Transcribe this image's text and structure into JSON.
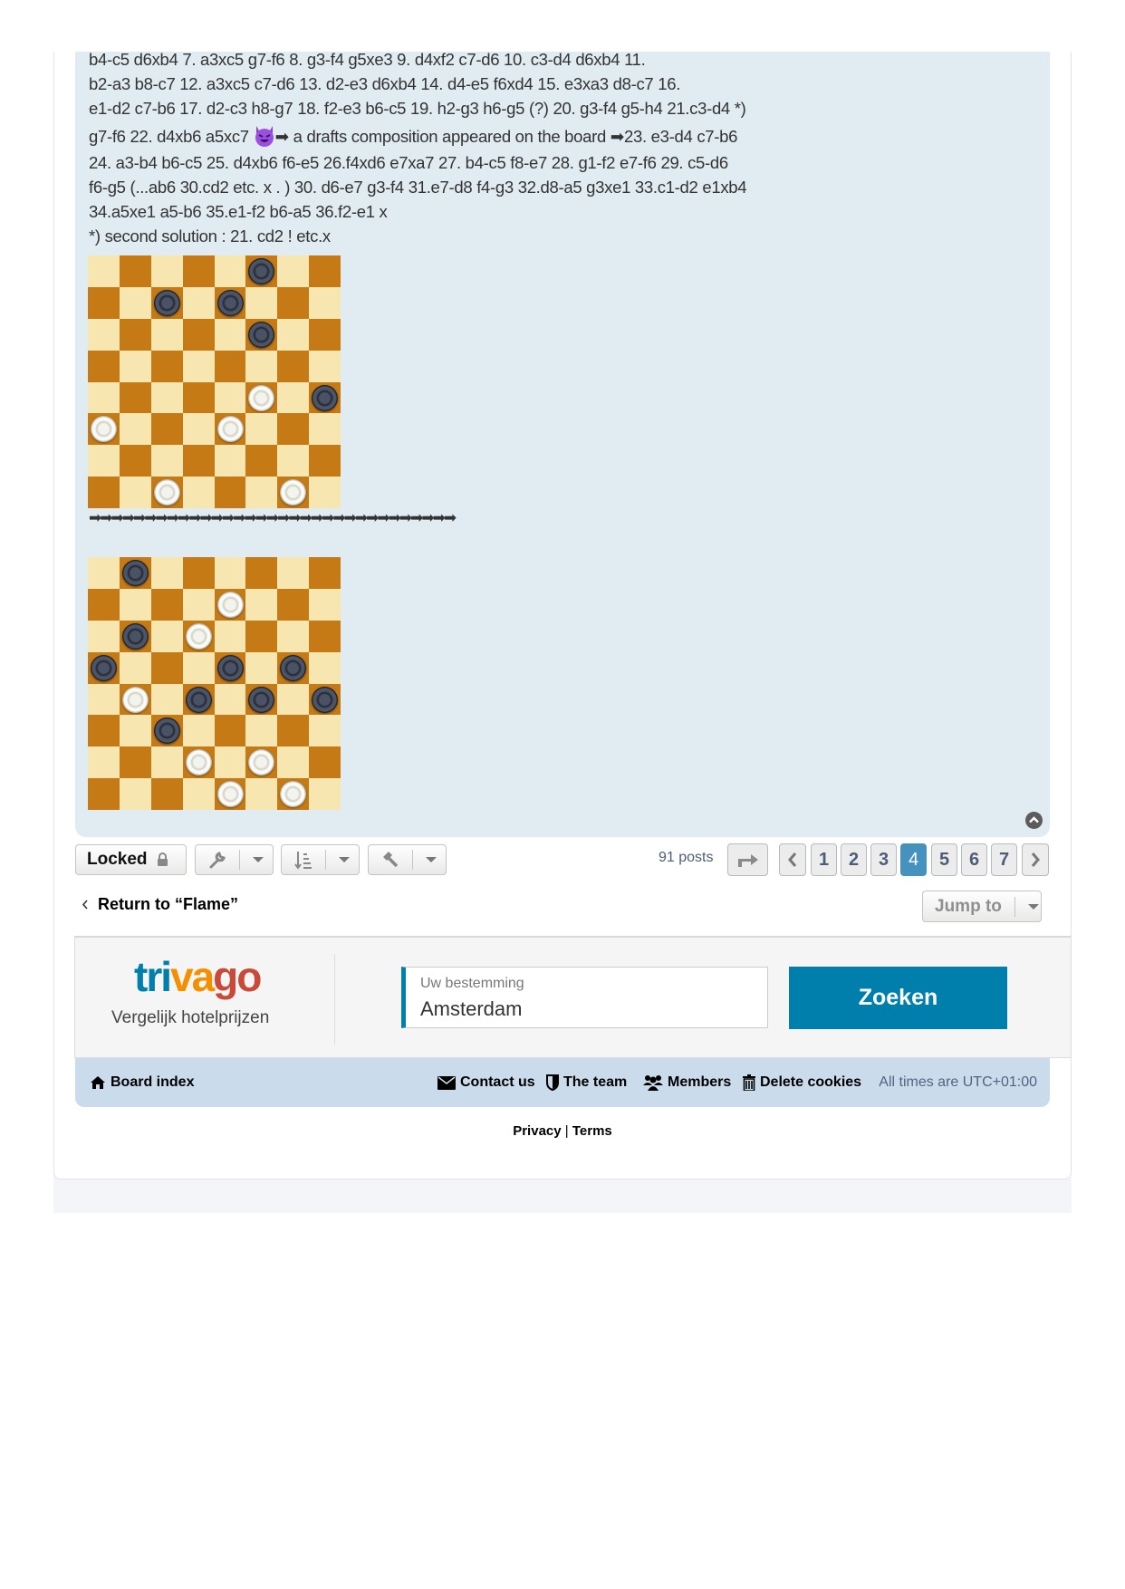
{
  "post": {
    "lines": [
      "b4-c5 d6xb4 7. a3xc5 g7-f6 8. g3-f4 g5xe3 9. d4xf2 c7-d6 10. c3-d4 d6xb4 11.",
      "b2-a3 b8-c7 12. a3xc5 c7-d6 13. d2-e3 d6xb4 14. d4-e5 f6xd4 15. e3xa3 d8-c7 16.",
      "e1-d2 c7-b6 17. d2-c3 h8-g7 18. f2-e3 b6-c5 19. h2-g3 h6-g5 (?) 20. g3-f4 g5-h4 21.c3-d4 *)"
    ],
    "line4_a": "g7-f6 22. d4xb6 a5xc7 ",
    "line4_emoji": "smiling-devil-emoji",
    "line4_b": "➡ a drafts composition appeared on the board ➡23. e3-d4 c7-b6",
    "lines2": [
      "24. a3-b4 b6-c5 25. d4xb6 f6-e5 26.f4xd6 e7xa7 27. b4-c5 f8-e7 28. g1-f2 e7-f6 29. c5-d6",
      "f6-g5 (...ab6 30.cd2 etc. x . ) 30. d6-e7 g3-f4 31.e7-d8 f4-g3 32.d8-a5 g3xe1 33.c1-d2 e1xb4",
      "34.a5xe1 a5-b6 35.e1-f2 b6-a5 36.f2-e1 x",
      "*) second solution : 21. cd2 ! etc.x"
    ],
    "arrows": "➡➡➡➡➡➡➡➡➡➡➡➡➡➡➡➡➡➡➡➡➡➡➡➡➡➡➡➡➡➡➡➡➡",
    "boards": [
      {
        "pieces": [
          [
            0,
            5,
            "b"
          ],
          [
            1,
            2,
            "b"
          ],
          [
            1,
            4,
            "b"
          ],
          [
            2,
            5,
            "b"
          ],
          [
            4,
            5,
            "w"
          ],
          [
            4,
            7,
            "b"
          ],
          [
            5,
            0,
            "w"
          ],
          [
            5,
            4,
            "w"
          ],
          [
            7,
            2,
            "w"
          ],
          [
            7,
            6,
            "w"
          ]
        ]
      },
      {
        "pieces": [
          [
            0,
            1,
            "b"
          ],
          [
            1,
            4,
            "w"
          ],
          [
            2,
            1,
            "b"
          ],
          [
            2,
            3,
            "w"
          ],
          [
            3,
            0,
            "b"
          ],
          [
            3,
            4,
            "b"
          ],
          [
            3,
            6,
            "b"
          ],
          [
            4,
            1,
            "w"
          ],
          [
            4,
            3,
            "b"
          ],
          [
            4,
            5,
            "b"
          ],
          [
            4,
            7,
            "b"
          ],
          [
            5,
            2,
            "b"
          ],
          [
            6,
            3,
            "w"
          ],
          [
            6,
            5,
            "w"
          ],
          [
            7,
            4,
            "w"
          ],
          [
            7,
            6,
            "w"
          ]
        ]
      }
    ]
  },
  "actions": {
    "locked": "Locked",
    "tools": [
      "wrench-icon",
      "sort-icon",
      "hammer-icon"
    ]
  },
  "pagination": {
    "posts": "91 posts",
    "pages": [
      "1",
      "2",
      "3",
      "4",
      "5",
      "6",
      "7"
    ],
    "current": "4"
  },
  "nav": {
    "return": "Return to “Flame”",
    "jump": "Jump to"
  },
  "ad": {
    "brand": "trivago",
    "tagline": "Vergelijk hotelprijzen",
    "placeholder": "Uw bestemming",
    "value": "Amsterdam",
    "button": "Zoeken",
    "colors": {
      "button": "#007fad"
    }
  },
  "footer": {
    "board_index": "Board index",
    "contact": "Contact us",
    "team": "The team",
    "members": "Members",
    "cookies": "Delete cookies",
    "timezone": "All times are UTC+01:00",
    "privacy": "Privacy",
    "sep": "|",
    "terms": "Terms"
  },
  "colors": {
    "post_bg": "#e1ebf2",
    "active_page": "#4692bf",
    "footer_bg": "#cadceb"
  }
}
